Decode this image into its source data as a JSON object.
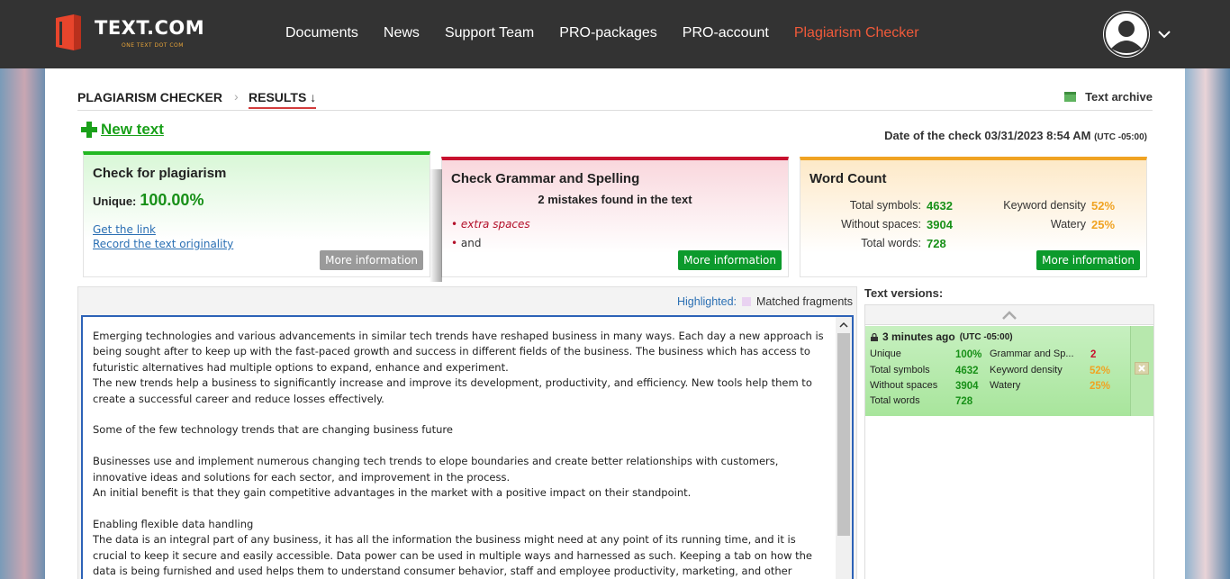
{
  "header": {
    "logo_text": "TEXT.COM",
    "logo_sub": "ONE TEXT DOT COM",
    "nav": [
      {
        "label": "Documents"
      },
      {
        "label": "News"
      },
      {
        "label": "Support Team"
      },
      {
        "label": "PRO-packages"
      },
      {
        "label": "PRO-account"
      },
      {
        "label": "Plagiarism Checker",
        "active": true
      }
    ],
    "accent_color": "#f05a3a"
  },
  "breadcrumb": {
    "root": "PLAGIARISM CHECKER",
    "current": "RESULTS ↓",
    "archive": "Text archive"
  },
  "new_text": "New text",
  "check_date": {
    "label": "Date of the check 03/31/2023 8:54 AM",
    "tz": "(UTC -05:00)"
  },
  "plagiarism": {
    "title": "Check for plagiarism",
    "unique_label": "Unique:",
    "unique_value": "100.00%",
    "link1": "Get the link",
    "link2": "Record the text originality",
    "more": "More information"
  },
  "grammar": {
    "title": "Check Grammar and Spelling",
    "summary": "2 mistakes found in the text",
    "items": [
      "extra spaces",
      "and"
    ],
    "more": "More information"
  },
  "wordcount": {
    "title": "Word Count",
    "total_symbols_label": "Total symbols:",
    "total_symbols": "4632",
    "without_spaces_label": "Without spaces:",
    "without_spaces": "3904",
    "total_words_label": "Total words:",
    "total_words": "728",
    "keyword_density_label": "Keyword density",
    "keyword_density": "52%",
    "watery_label": "Watery",
    "watery": "25%",
    "more": "More information"
  },
  "editor": {
    "highlighted_label": "Highlighted:",
    "matched_label": "Matched fragments",
    "text": "Emerging technologies and various advancements in similar tech trends have reshaped business in many ways. Each day a new approach is being sought after to keep up with the fast-paced growth and success in different fields of the business. The business which has access to futuristic alternatives had multiple options to expand, enhance and experiment.\nThe new trends help a business to significantly increase and improve its development, productivity, and efficiency. New tools help them to create a successful career and reduce losses effectively.\n\nSome of the few technology trends that are changing business future\n\nBusinesses use and implement numerous changing tech trends to elope boundaries and create better relationships with customers, innovative ideas and solutions for each sector, and improvement in the process.\nAn initial benefit is that they gain competitive advantages in the market with a positive impact on their standpoint.\n\nEnabling flexible data handling\nThe data is an integral part of any business, it has all the information the business might need at any point of its running time, and it is  crucial to keep it secure and easily accessible. Data power can be used in multiple ways and harnessed as such. Keeping a tab on how the data is being furnished and used helps them to understand consumer behavior, staff and employee productivity, marketing, and other similar processes that can help"
  },
  "versions": {
    "title": "Text versions:",
    "items": [
      {
        "time": "3 minutes ago",
        "tz": "(UTC -05:00)",
        "unique_label": "Unique",
        "unique": "100%",
        "grammar_label": "Grammar and Sp...",
        "grammar": "2",
        "total_symbols_label": "Total symbols",
        "total_symbols": "4632",
        "keyword_density_label": "Keyword density",
        "keyword_density": "52%",
        "without_spaces_label": "Without spaces",
        "without_spaces": "3904",
        "watery_label": "Watery",
        "watery": "25%",
        "total_words_label": "Total words",
        "total_words": "728"
      }
    ]
  }
}
